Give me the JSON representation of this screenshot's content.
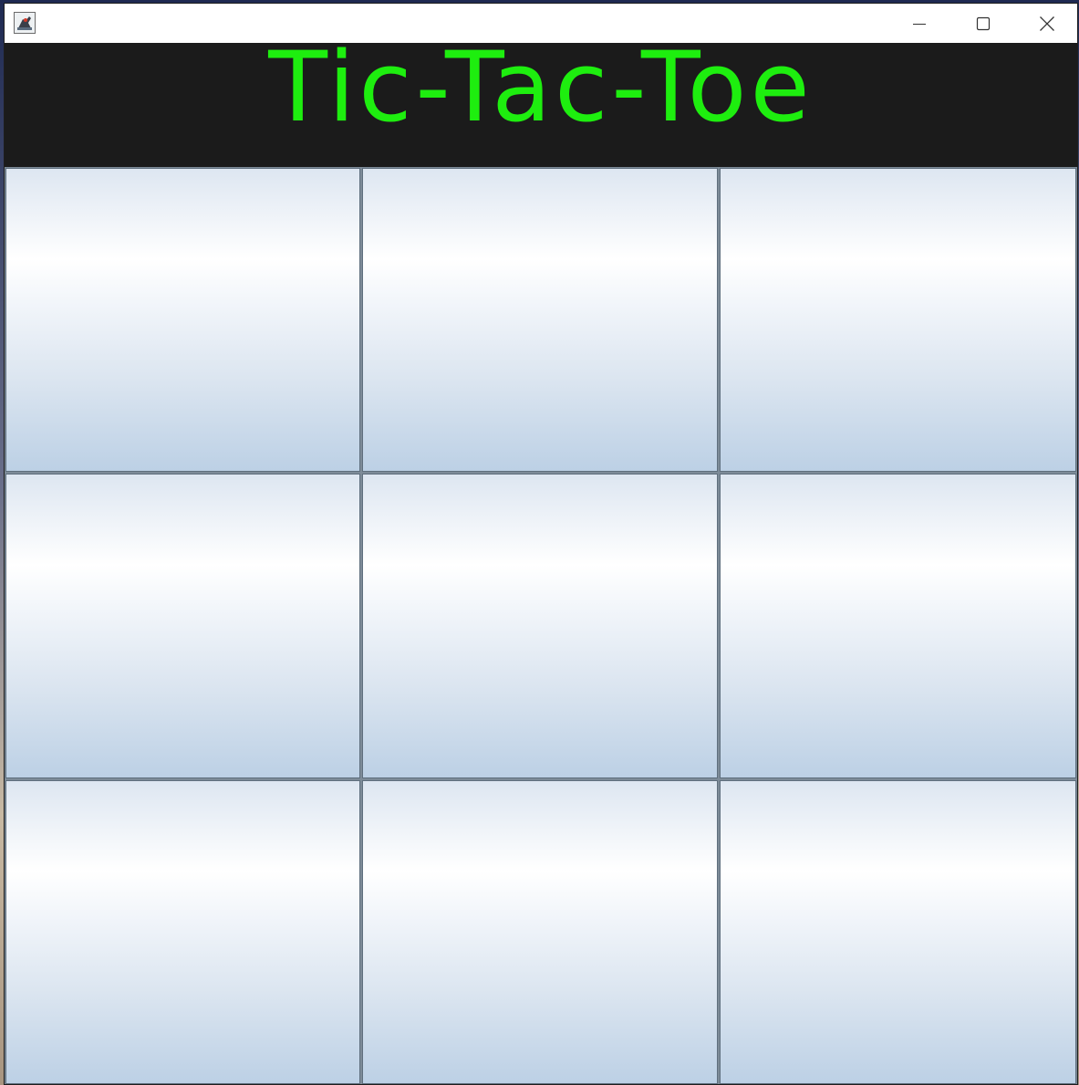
{
  "window": {
    "title": "",
    "app_icon": "java-duke-icon",
    "controls": {
      "minimize_icon": "minimize-icon",
      "maximize_icon": "maximize-icon",
      "close_icon": "close-icon"
    }
  },
  "header": {
    "title": "Tic-Tac-Toe",
    "title_color": "#1eee0f",
    "background": "#1b1b1b"
  },
  "board": {
    "cells": [
      "",
      "",
      "",
      "",
      "",
      "",
      "",
      "",
      ""
    ]
  }
}
